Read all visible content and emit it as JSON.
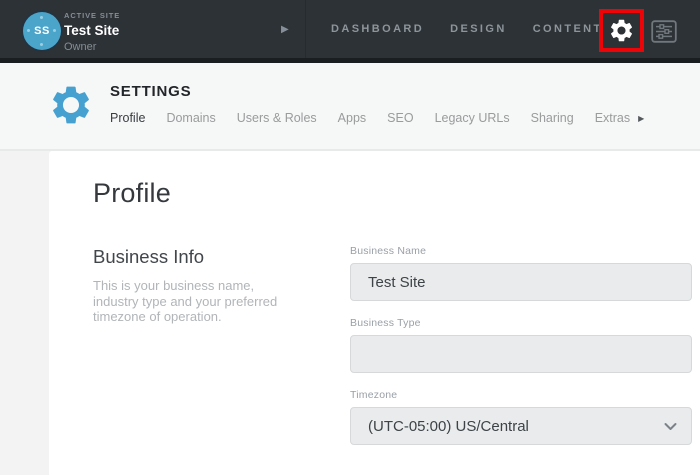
{
  "topbar": {
    "active_site_label": "ACTIVE SITE",
    "site_name": "Test Site",
    "site_role": "Owner",
    "avatar_initials": "SS",
    "expand_arrow": "▶",
    "nav_items": [
      {
        "label": "DASHBOARD"
      },
      {
        "label": "DESIGN"
      },
      {
        "label": "CONTENT"
      }
    ]
  },
  "settings_header": {
    "title": "SETTINGS",
    "tabs": [
      {
        "label": "Profile",
        "active": true
      },
      {
        "label": "Domains",
        "active": false
      },
      {
        "label": "Users & Roles",
        "active": false
      },
      {
        "label": "Apps",
        "active": false
      },
      {
        "label": "SEO",
        "active": false
      },
      {
        "label": "Legacy URLs",
        "active": false
      },
      {
        "label": "Sharing",
        "active": false
      },
      {
        "label": "Extras",
        "active": false
      }
    ],
    "extras_arrow": "▶"
  },
  "content": {
    "page_title": "Profile",
    "business_info": {
      "heading": "Business Info",
      "description_lines": [
        "This is your business name,",
        "industry type and your preferred",
        "timezone of operation."
      ]
    },
    "form": {
      "business_name": {
        "label": "Business Name",
        "value": "Test Site"
      },
      "business_type": {
        "label": "Business Type",
        "value": ""
      },
      "timezone": {
        "label": "Timezone",
        "value": "(UTC-05:00) US/Central"
      }
    }
  },
  "colors": {
    "topbar_bg": "#2d3237",
    "topbar_strip": "#1b1e21",
    "avatar_blue": "#4ba5cb",
    "accent_blue": "#46a1d0",
    "annotation_red": "#ec0408",
    "band_bg": "#f6f7f7",
    "content_bg": "#f3f3f4",
    "input_bg": "#e9ebec"
  }
}
